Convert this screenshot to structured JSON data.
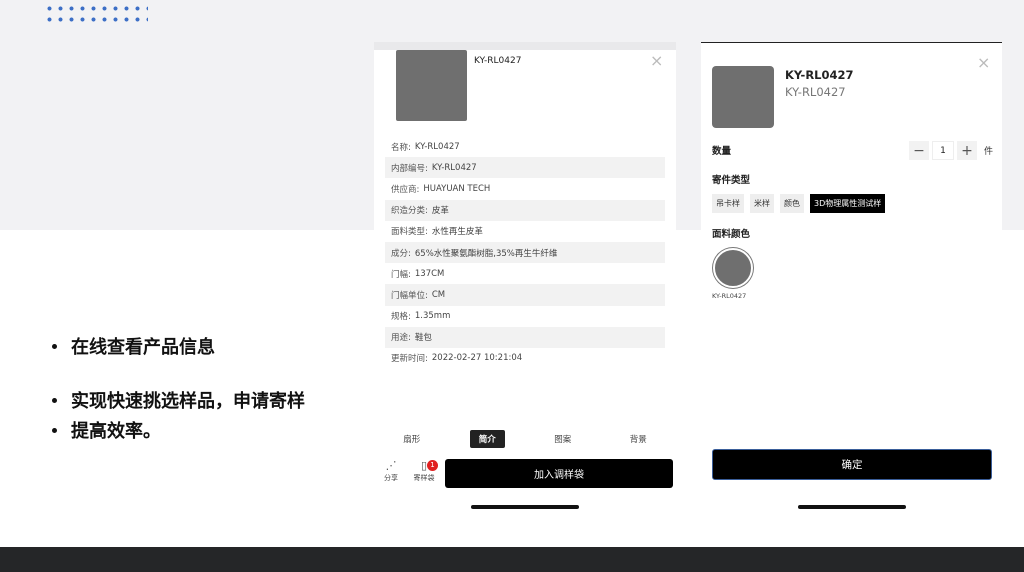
{
  "slide": {
    "bullets": [
      "在线查看产品信息",
      "实现快速挑选样品，申请寄样",
      "提高效率。"
    ]
  },
  "product_detail": {
    "title": "KY-RL0427",
    "close_icon": "×",
    "info": [
      {
        "k": "名称:",
        "v": "KY-RL0427"
      },
      {
        "k": "内部编号:",
        "v": "KY-RL0427"
      },
      {
        "k": "供应商:",
        "v": "HUAYUAN TECH"
      },
      {
        "k": "织造分类:",
        "v": "皮革"
      },
      {
        "k": "面料类型:",
        "v": "水性再生皮革"
      },
      {
        "k": "成分:",
        "v": "65%水性聚氨酯树脂,35%再生牛纤维"
      },
      {
        "k": "门幅:",
        "v": "137CM"
      },
      {
        "k": "门幅单位:",
        "v": "CM"
      },
      {
        "k": "规格:",
        "v": "1.35mm"
      },
      {
        "k": "用途:",
        "v": "鞋包"
      },
      {
        "k": "更新时间:",
        "v": "2022-02-27 10:21:04"
      }
    ],
    "tabs": [
      "扇形",
      "简介",
      "图案",
      "背景"
    ],
    "active_tab": "简介",
    "share_label": "分享",
    "bag_label": "寄样袋",
    "bag_count": "1",
    "add_button": "加入调样袋"
  },
  "sample_request": {
    "title": "KY-RL0427",
    "subtitle": "KY-RL0427",
    "close_icon": "×",
    "quantity_label": "数量",
    "quantity_value": "1",
    "minus": "−",
    "plus": "+",
    "unit": "件",
    "type_label": "寄件类型",
    "types": [
      "吊卡样",
      "米样",
      "颜色",
      "3D物理属性测试样"
    ],
    "active_type": "3D物理属性测试样",
    "color_label": "面料颜色",
    "color_name": "KY-RL0427",
    "confirm_button": "确定"
  },
  "colors": {
    "swatch": "#6f6f6f",
    "primary": "#000000",
    "badge": "#e02020",
    "dots": "#3d6fc6"
  },
  "icons": {
    "share": "share-icon",
    "bag": "bag-icon",
    "close": "close-icon"
  }
}
